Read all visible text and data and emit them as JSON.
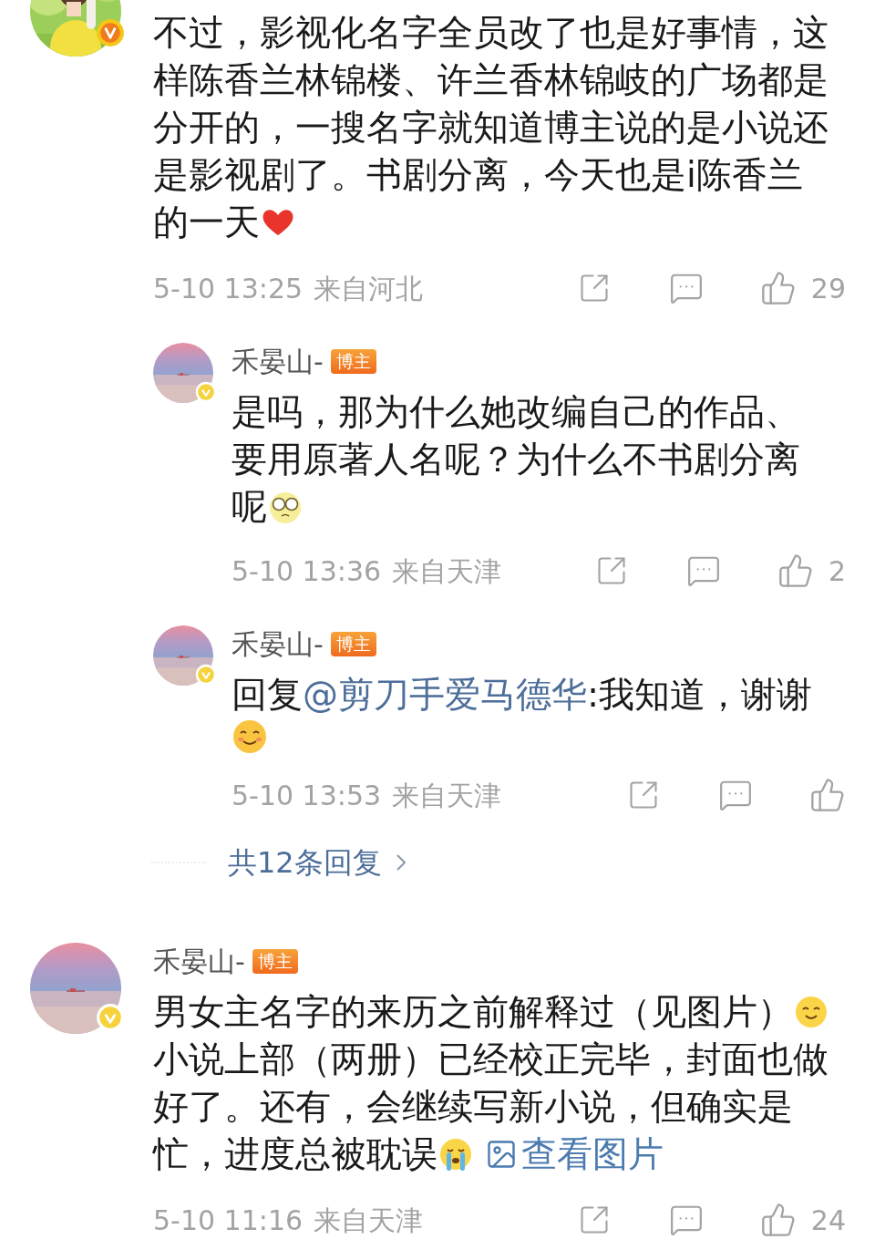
{
  "comments": [
    {
      "avatar": {
        "kind": "portrait",
        "verified": {
          "kind": "vip"
        }
      },
      "body": [
        {
          "kind": "para",
          "text": "不过，影视化名字全员改了也是好事情，这样陈香兰林锦楼、许兰香林锦岐的广场都是分开的，一搜名字就知道博主说的是小说还是影视剧了。书剧分离，今天也是i陈香兰"
        },
        {
          "kind": "text",
          "text": "的一天"
        },
        {
          "kind": "heart"
        }
      ],
      "time": "5-10 13:25",
      "location": "来自河北",
      "likes": "29",
      "replies": [
        {
          "avatar": {
            "kind": "seascape",
            "verified": {
              "kind": "personal"
            }
          },
          "name": "禾晏山-",
          "badge": "博主",
          "body": [
            {
              "kind": "para",
              "text": "是吗，那为什么她改编自己的作品、要用原著人名呢？为什么不书剧分离"
            },
            {
              "kind": "text",
              "text": "呢"
            },
            {
              "kind": "glasses"
            }
          ],
          "time": "5-10 13:36",
          "location": "来自天津",
          "likes": "2"
        },
        {
          "avatar": {
            "kind": "seascape",
            "verified": {
              "kind": "personal"
            }
          },
          "name": "禾晏山-",
          "badge": "博主",
          "body": [
            {
              "kind": "text",
              "text": "回复"
            },
            {
              "kind": "mention",
              "text": "@剪刀手爱马德华"
            },
            {
              "kind": "text",
              "text": ":我知道，谢谢"
            },
            {
              "kind": "blush"
            }
          ],
          "time": "5-10 13:53",
          "location": "来自天津"
        }
      ],
      "more_replies": "共12条回复"
    },
    {
      "avatar": {
        "kind": "seascape",
        "verified": {
          "kind": "personal"
        }
      },
      "name": "禾晏山-",
      "badge": "博主",
      "body": [
        {
          "kind": "text",
          "text": "男女主名字的来历之前解释过（见图片）"
        },
        {
          "kind": "smile"
        },
        {
          "kind": "para",
          "text": "小说上部（两册）已经校正完毕，封面也做好了。还有，会继续写新小说，但确实是"
        },
        {
          "kind": "text",
          "text": "忙，进度总被耽误"
        },
        {
          "kind": "cry"
        },
        {
          "kind": "link",
          "text": "查看图片"
        }
      ],
      "time": "5-10 11:16",
      "location": "来自天津",
      "likes": "24"
    }
  ]
}
